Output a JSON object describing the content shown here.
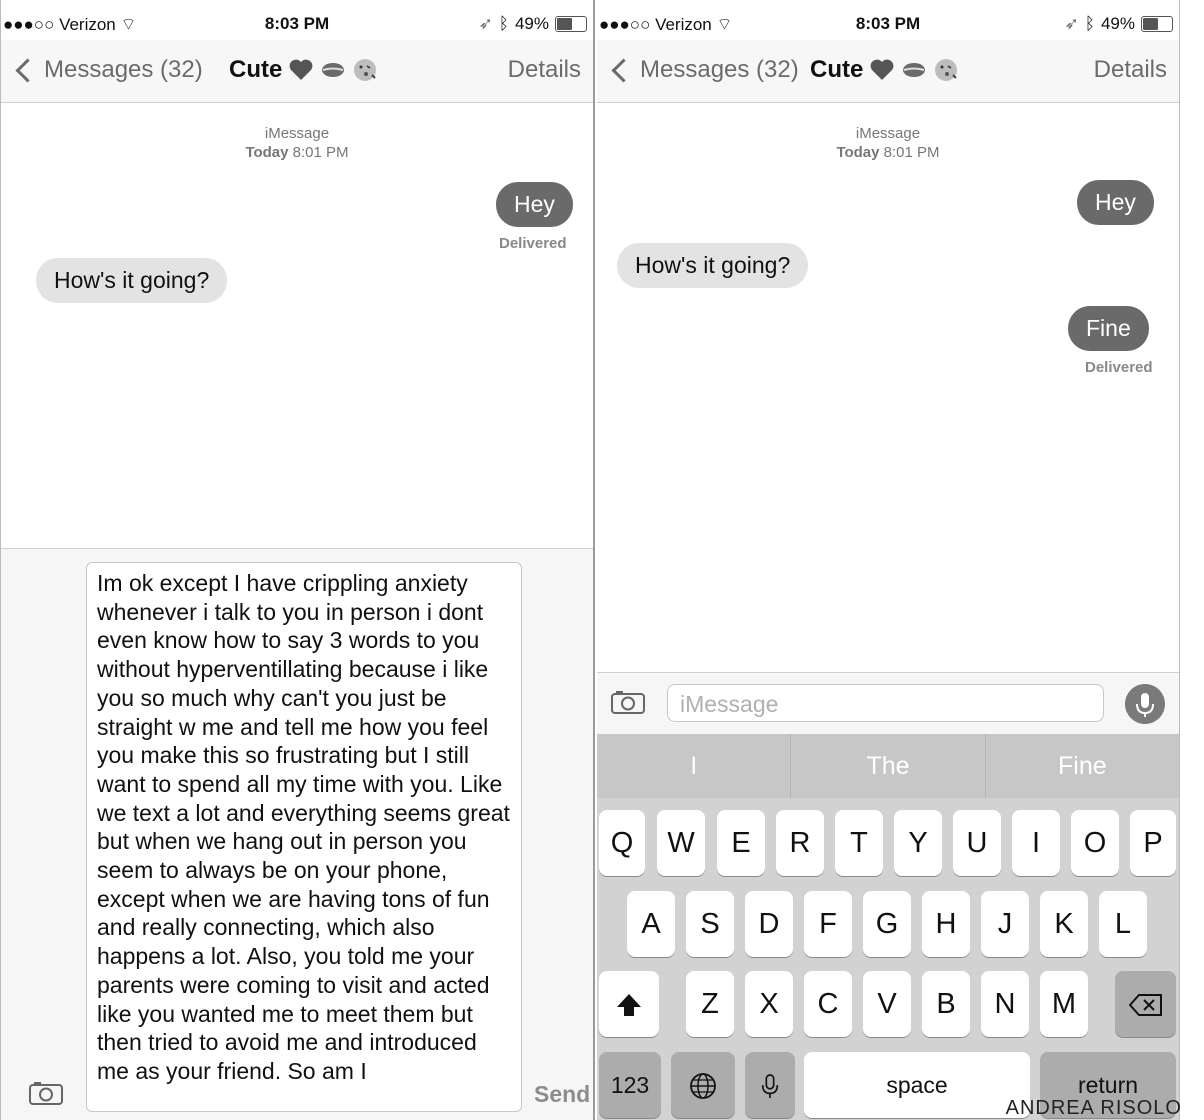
{
  "status": {
    "carrier": "●●●○○ Verizon",
    "time": "8:03 PM",
    "battery_text": "49%",
    "battery_level": 0.49
  },
  "nav": {
    "back_label": "Messages (32)",
    "contact": "Cute",
    "details_label": "Details"
  },
  "thread": {
    "service": "iMessage",
    "date_word": "Today",
    "date_time": "8:01 PM"
  },
  "left_screen": {
    "messages": [
      {
        "text": "Hey",
        "direction": "outgoing"
      },
      {
        "text": "How's it going?",
        "direction": "incoming"
      }
    ],
    "delivered": "Delivered",
    "draft": "Im ok except I have crippling anxiety whenever i talk to you in person i dont even know how to say 3 words to you without hyperventillating because i like you so much why can't you just be straight w me and tell me how you feel you make this so frustrating but I still want to spend all my time with you. Like we text a lot and everything seems great but when we hang out in person you seem to always be on your phone, except when we are having tons of fun and really connecting, which also happens a lot. Also, you told me your parents were coming to visit and acted like you wanted me to meet them but then tried to avoid me and introduced me as your friend. So am I",
    "send_label": "Send"
  },
  "right_screen": {
    "messages": [
      {
        "text": "Hey",
        "direction": "outgoing"
      },
      {
        "text": "How's it going?",
        "direction": "incoming"
      },
      {
        "text": "Fine",
        "direction": "outgoing"
      }
    ],
    "delivered": "Delivered",
    "input_placeholder": "iMessage",
    "predictions": [
      "I",
      "The",
      "Fine"
    ],
    "keyboard": {
      "row1": [
        "Q",
        "W",
        "E",
        "R",
        "T",
        "Y",
        "U",
        "I",
        "O",
        "P"
      ],
      "row2": [
        "A",
        "S",
        "D",
        "F",
        "G",
        "H",
        "J",
        "K",
        "L"
      ],
      "row3": [
        "Z",
        "X",
        "C",
        "V",
        "B",
        "N",
        "M"
      ],
      "numbers_key": "123",
      "space_key": "space",
      "return_key": "return"
    }
  },
  "credit": "ANDREA RISOLO"
}
